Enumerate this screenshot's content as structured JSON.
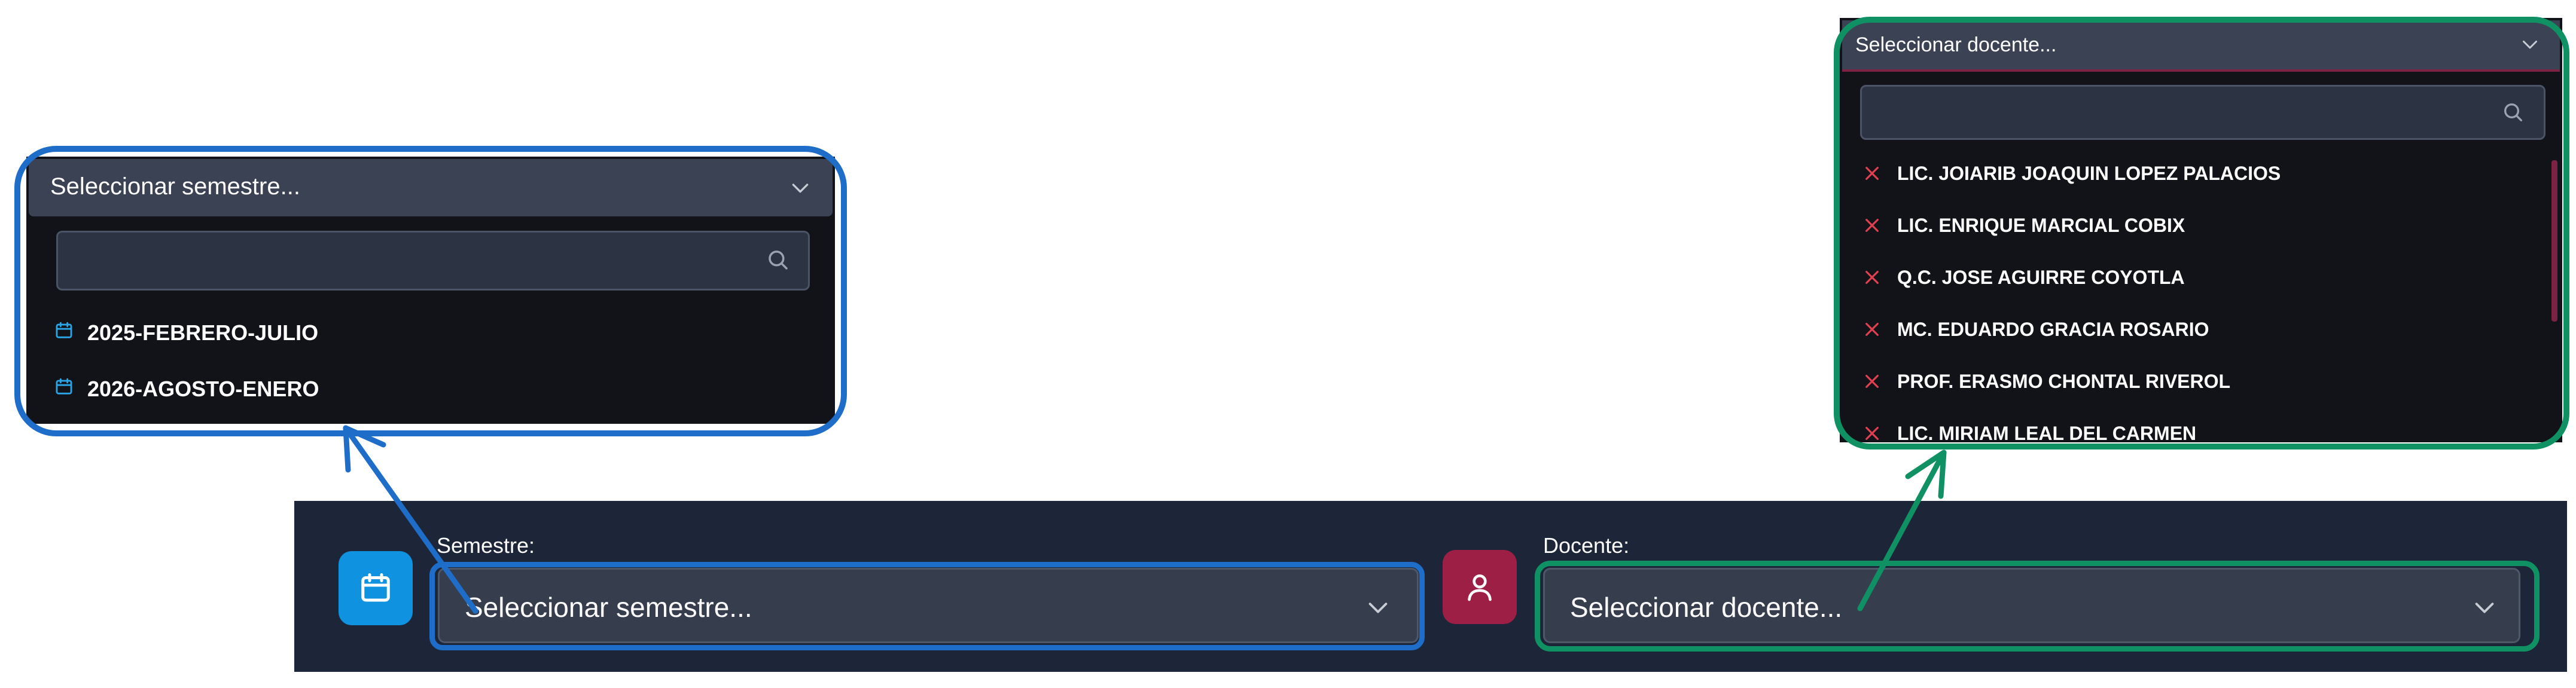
{
  "semester_dropdown": {
    "header_text": "Seleccionar semestre...",
    "search_value": "",
    "options": [
      {
        "label": "2025-FEBRERO-JULIO",
        "icon": "calendar-icon"
      },
      {
        "label": "2026-AGOSTO-ENERO",
        "icon": "calendar-icon"
      }
    ]
  },
  "teacher_dropdown": {
    "header_text": "Seleccionar docente...",
    "search_value": "",
    "options": [
      {
        "label": "LIC. JOIARIB JOAQUIN LOPEZ PALACIOS",
        "icon": "x-icon"
      },
      {
        "label": "LIC. ENRIQUE MARCIAL COBIX",
        "icon": "x-icon"
      },
      {
        "label": "Q.C. JOSE AGUIRRE COYOTLA",
        "icon": "x-icon"
      },
      {
        "label": "MC. EDUARDO GRACIA ROSARIO",
        "icon": "x-icon"
      },
      {
        "label": "PROF. ERASMO CHONTAL RIVEROL",
        "icon": "x-icon"
      },
      {
        "label": "LIC. MIRIAM LEAL DEL CARMEN",
        "icon": "x-icon"
      }
    ]
  },
  "filter_bar": {
    "semester": {
      "label": "Semestre:",
      "placeholder": "Seleccionar semestre...",
      "icon": "calendar-icon"
    },
    "teacher": {
      "label": "Docente:",
      "placeholder": "Seleccionar docente...",
      "icon": "user-icon"
    }
  },
  "colors": {
    "panel_bg": "#121319",
    "bar_bg": "#1c2638",
    "select_bg": "#363d4c",
    "calendar_button": "#0f93e0",
    "user_button": "#9e1f46",
    "option_icon_blue": "#2aa6e8",
    "option_icon_red": "#e04050",
    "callout_blue": "#1e6ec9",
    "callout_green": "#109163"
  }
}
